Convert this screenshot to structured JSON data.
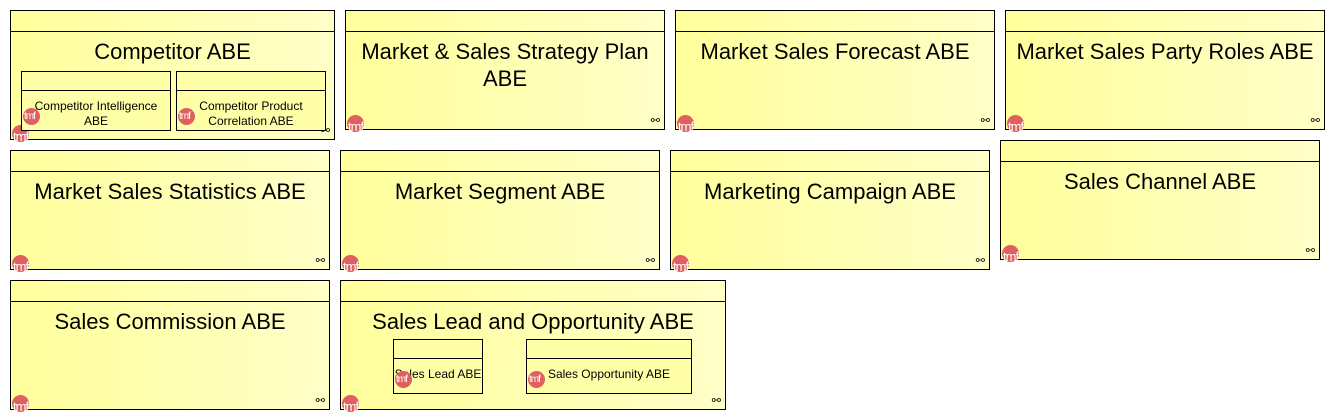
{
  "logo_text": "tmf",
  "boxes": [
    {
      "title": "Competitor ABE",
      "children": [
        "Competitor Intelligence ABE",
        "Competitor Product Correlation ABE"
      ]
    },
    {
      "title": "Market & Sales Strategy Plan ABE"
    },
    {
      "title": "Market Sales Forecast ABE"
    },
    {
      "title": "Market Sales Party Roles ABE"
    },
    {
      "title": "Market Sales Statistics ABE"
    },
    {
      "title": "Market Segment ABE"
    },
    {
      "title": "Marketing Campaign ABE"
    },
    {
      "title": "Sales Channel ABE"
    },
    {
      "title": "Sales Commission ABE"
    },
    {
      "title": "Sales Lead and Opportunity ABE",
      "children": [
        "Sales Lead ABE",
        "Sales Opportunity ABE"
      ]
    }
  ],
  "link_icon": "⚯"
}
